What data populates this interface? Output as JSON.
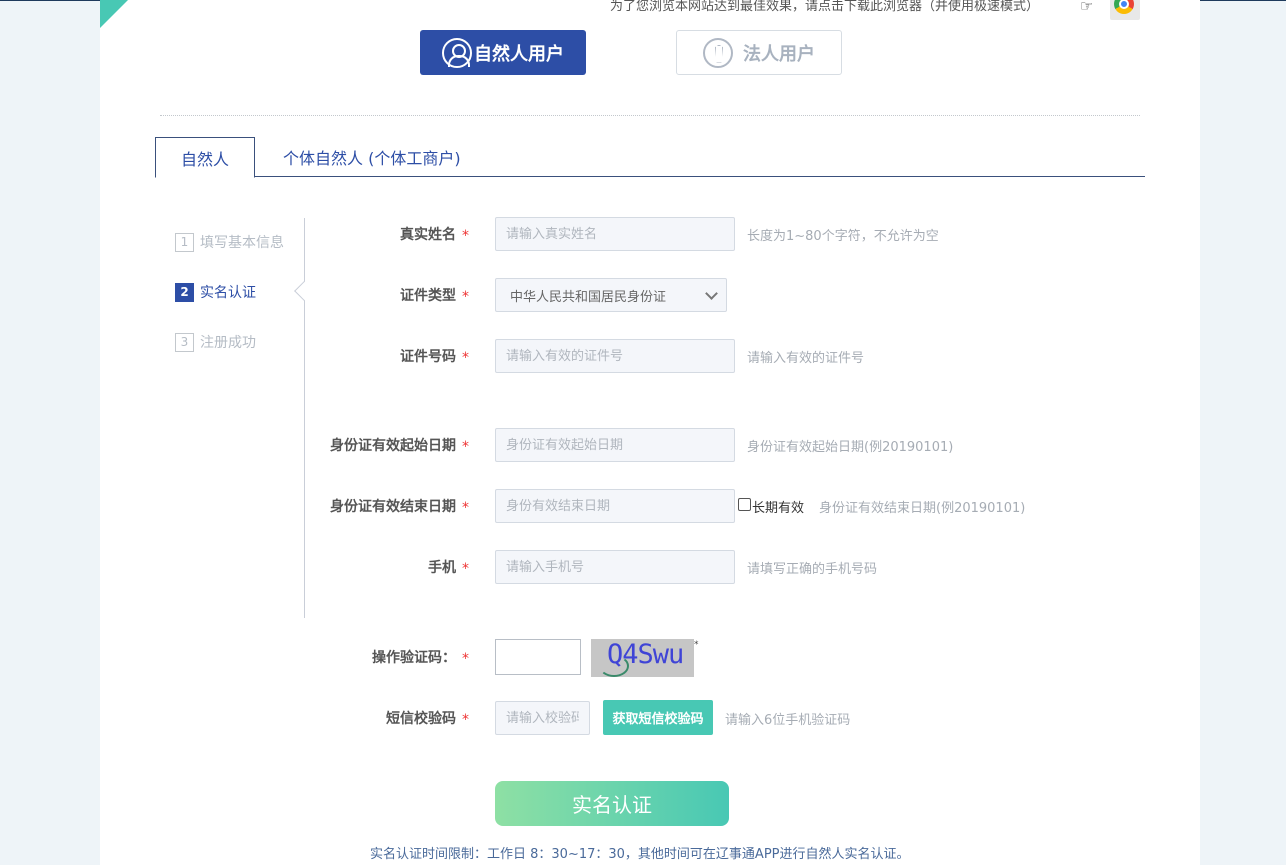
{
  "header": {
    "browser_notice": "为了您浏览本网站达到最佳效果，请点击下载此浏览器（并使用极速模式）",
    "hand_icon": "pointing-hand-icon",
    "browser_icon": "chrome-icon"
  },
  "user_types": {
    "natural": "自然人用户",
    "legal": "法人用户"
  },
  "tabs": {
    "natural": "自然人",
    "individual": "个体自然人 (个体工商户)"
  },
  "steps": [
    {
      "num": "1",
      "label": "填写基本信息"
    },
    {
      "num": "2",
      "label": "实名认证"
    },
    {
      "num": "3",
      "label": "注册成功"
    }
  ],
  "form": {
    "required_mark": "*",
    "name": {
      "label": "真实姓名",
      "placeholder": "请输入真实姓名",
      "hint": "长度为1~80个字符，不允许为空"
    },
    "id_type": {
      "label": "证件类型",
      "value": "中华人民共和国居民身份证"
    },
    "id_number": {
      "label": "证件号码",
      "placeholder": "请输入有效的证件号",
      "hint": "请输入有效的证件号"
    },
    "start_date": {
      "label": "身份证有效起始日期",
      "placeholder": "身份证有效起始日期",
      "hint": "身份证有效起始日期(例20190101)"
    },
    "end_date": {
      "label": "身份证有效结束日期",
      "placeholder": "身份有效结束日期",
      "checkbox_label": "长期有效",
      "hint": "身份证有效结束日期(例20190101)"
    },
    "phone": {
      "label": "手机",
      "placeholder": "请输入手机号",
      "hint": "请填写正确的手机号码"
    },
    "captcha": {
      "label": "操作验证码：",
      "image_text": "Q4Swu",
      "mark": "*"
    },
    "sms": {
      "label": "短信校验码",
      "placeholder": "请输入校验码",
      "button": "获取短信校验码",
      "hint": "请输入6位手机验证码"
    }
  },
  "submit": "实名认证",
  "footer_note": "实名认证时间限制：工作日 8：30~17：30，其他时间可在辽事通APP进行自然人实名认证。"
}
